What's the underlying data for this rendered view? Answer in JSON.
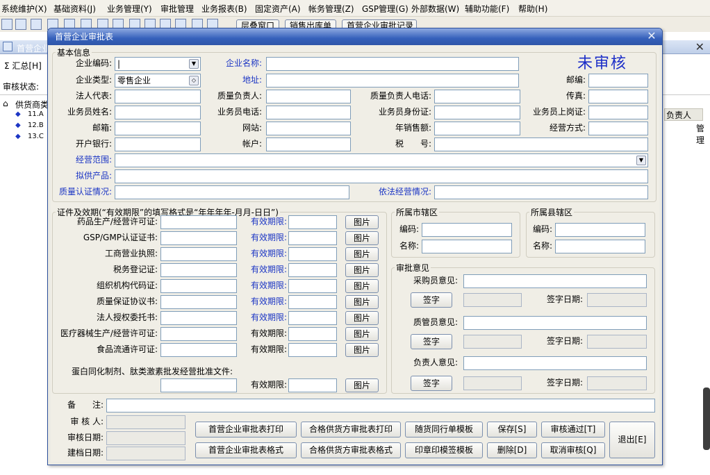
{
  "menu": [
    "系统维护(X)",
    "基础资料(J)",
    "业务管理(Y)",
    "审批管理",
    "业务报表(B)",
    "固定资产(A)",
    "帐务管理(Z)",
    "GSP管理(G)",
    "外部数据(W)",
    "辅助功能(F)",
    "帮助(H)"
  ],
  "toolbar": {
    "buttons": [
      "层叠窗口",
      "销售出库单",
      "首营企业审批记录"
    ]
  },
  "bg": {
    "title": "首营企业",
    "summary": "Σ 汇总[H]",
    "audit_label": "审核状态:",
    "tree_root": "供货商类",
    "tree_items": [
      "11.A",
      "12.B",
      "13.C"
    ],
    "col_header": "负责人",
    "cell": "管理"
  },
  "dialog": {
    "title": "首营企业审批表",
    "status": "未审核",
    "basic": {
      "legend": "基本信息",
      "company_code": {
        "label": "企业编码:",
        "value": "|"
      },
      "company_name": {
        "label": "企业名称:",
        "value": ""
      },
      "company_type": {
        "label": "企业类型:",
        "value": "零售企业"
      },
      "address": {
        "label": "地址:",
        "value": ""
      },
      "postcode": {
        "label": "邮编:",
        "value": ""
      },
      "legal_rep": {
        "label": "法人代表:",
        "value": ""
      },
      "quality_head": {
        "label": "质量负责人:",
        "value": ""
      },
      "quality_head_phone": {
        "label": "质量负责人电话:",
        "value": ""
      },
      "fax": {
        "label": "传真:",
        "value": ""
      },
      "sales_name": {
        "label": "业务员姓名:",
        "value": ""
      },
      "sales_phone": {
        "label": "业务员电话:",
        "value": ""
      },
      "sales_id": {
        "label": "业务员身份证:",
        "value": ""
      },
      "sales_cert": {
        "label": "业务员上岗证:",
        "value": ""
      },
      "email": {
        "label": "邮箱:",
        "value": ""
      },
      "website": {
        "label": "网站:",
        "value": ""
      },
      "annual_sales": {
        "label": "年销售额:",
        "value": ""
      },
      "business_mode": {
        "label": "经营方式:",
        "value": ""
      },
      "bank": {
        "label": "开户银行:",
        "value": ""
      },
      "account": {
        "label": "帐户:",
        "value": ""
      },
      "tax_no": {
        "label": "税　　号:",
        "value": ""
      },
      "scope": {
        "label": "经营范围:",
        "value": ""
      },
      "products": {
        "label": "拟供产品:",
        "value": ""
      },
      "quality_cert": {
        "label": "质量认证情况:",
        "value": ""
      },
      "legal_status": {
        "label": "依法经营情况:",
        "value": ""
      }
    },
    "licenses": {
      "legend": "证件及效期(“有效期限”的填写格式是“年年年年-月月-日日”)",
      "validity_label": "有效期限:",
      "pic_label": "图片",
      "items": [
        {
          "label": "药品生产/经营许可证:",
          "blue": true
        },
        {
          "label": "GSP/GMP认证证书:",
          "blue": true
        },
        {
          "label": "工商营业执照:",
          "blue": true
        },
        {
          "label": "税务登记证:",
          "blue": true
        },
        {
          "label": "组织机构代码证:",
          "blue": true
        },
        {
          "label": "质量保证协议书:",
          "blue": true
        },
        {
          "label": "法人授权委托书:",
          "blue": true
        },
        {
          "label": "医疗器械生产/经营许可证:",
          "blue": false
        },
        {
          "label": "食品流通许可证:",
          "blue": false
        }
      ],
      "extra_label": "蛋白同化制剂、肽类激素批发经营批准文件:"
    },
    "city": {
      "legend": "所属市辖区",
      "code_label": "编码:",
      "name_label": "名称:"
    },
    "county": {
      "legend": "所属县辖区",
      "code_label": "编码:",
      "name_label": "名称:"
    },
    "approval": {
      "legend": "审批意见",
      "buyer_label": "采购员意见:",
      "qa_label": "质管员意见:",
      "head_label": "负责人意见:",
      "sign_label": "签字",
      "sign_date_label": "签字日期:"
    },
    "footer": {
      "remark_label": "备　　注:",
      "auditor_label": "审 核 人:",
      "audit_date_label": "审核日期:",
      "create_date_label": "建档日期:",
      "buttons": {
        "print_first": "首营企业审批表打印",
        "print_qualified": "合格供货方审批表打印",
        "template_goods": "随货同行单模板",
        "save": "保存[S]",
        "approve": "审核通过[T]",
        "exit": "退出[E]",
        "format_first": "首营企业审批表格式",
        "format_qualified": "合格供货方审批表格式",
        "template_seal": "印章印模签模板",
        "delete": "删除[D]",
        "cancel_audit": "取消审核[Q]"
      }
    }
  }
}
